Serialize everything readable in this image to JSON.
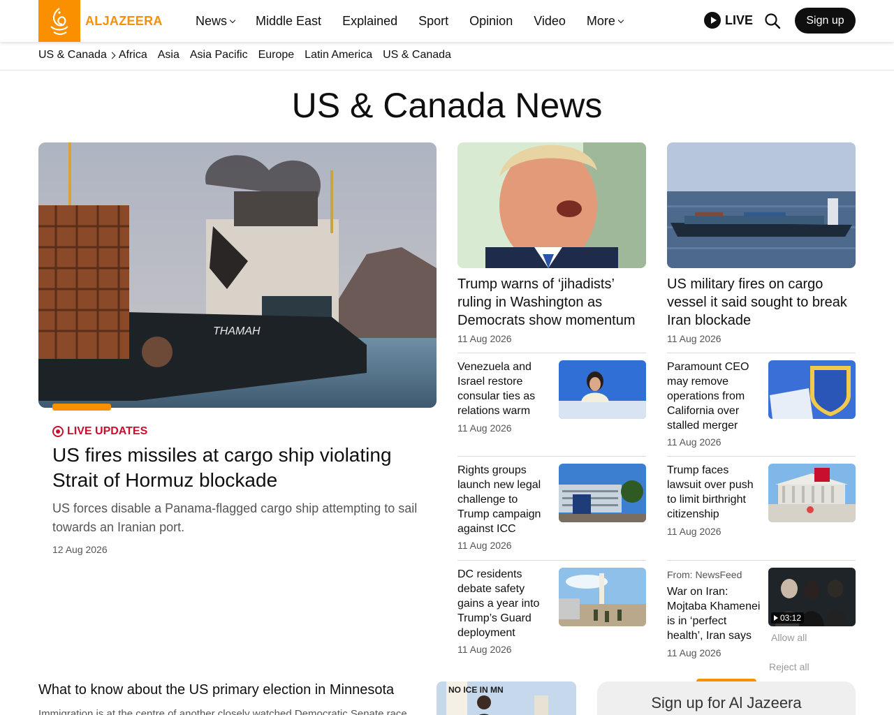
{
  "brand": {
    "name": "ALJAZEERA",
    "color": "#fa9000"
  },
  "nav": {
    "items": [
      {
        "label": "News",
        "dropdown": true
      },
      {
        "label": "Middle East",
        "dropdown": false
      },
      {
        "label": "Explained",
        "dropdown": false
      },
      {
        "label": "Sport",
        "dropdown": false
      },
      {
        "label": "Opinion",
        "dropdown": false
      },
      {
        "label": "Video",
        "dropdown": false
      },
      {
        "label": "More",
        "dropdown": true
      }
    ],
    "live_label": "LIVE",
    "signup_label": "Sign up"
  },
  "subnav": {
    "current": "US & Canada",
    "links": [
      "Africa",
      "Asia",
      "Asia Pacific",
      "Europe",
      "Latin America",
      "US & Canada"
    ]
  },
  "page_title": "US & Canada News",
  "hero": {
    "badge": "LIVE UPDATES",
    "title": "US fires missiles at cargo ship violating Strait of Hormuz blockade",
    "description": "US forces disable a Panama-flagged cargo ship attempting to sail towards an Iranian port.",
    "date": "12 Aug 2026",
    "image_caption_ship": "THAMAH"
  },
  "medium_cards": [
    {
      "title": "Trump warns of ‘jihadists’ ruling in Washington as Democrats show momentum",
      "date": "11 Aug 2026"
    },
    {
      "title": "US military fires on cargo vessel it said sought to break Iran blockade",
      "date": "11 Aug 2026"
    }
  ],
  "small_cards_left": [
    {
      "title": "Venezuela and Israel restore consular ties as relations warm",
      "date": "11 Aug 2026"
    },
    {
      "title": "Rights groups launch new legal challenge to Trump campaign against ICC",
      "date": "11 Aug 2026"
    },
    {
      "title": "DC residents debate safety gains a year into Trump’s Guard deployment",
      "date": "11 Aug 2026"
    }
  ],
  "small_cards_right": [
    {
      "title": "Paramount CEO may remove operations from California over stalled merger",
      "date": "11 Aug 2026"
    },
    {
      "title": "Trump faces lawsuit over push to limit birthright citizenship",
      "date": "11 Aug 2026"
    },
    {
      "source": "From: NewsFeed",
      "title": "War on Iran: Mojtaba Khamenei is in ‘perfect health’, Iran says",
      "date": "11 Aug 2026",
      "duration": "03:12"
    }
  ],
  "consent": {
    "allow_all": "Allow all",
    "reject_all": "Reject all"
  },
  "bottom": {
    "title": "What to know about the US primary election in Minnesota",
    "description": "Immigration is at the centre of another closely watched Democratic Senate race",
    "image_text": "NO ICE IN MN",
    "signup_title": "Sign up for Al Jazeera"
  }
}
